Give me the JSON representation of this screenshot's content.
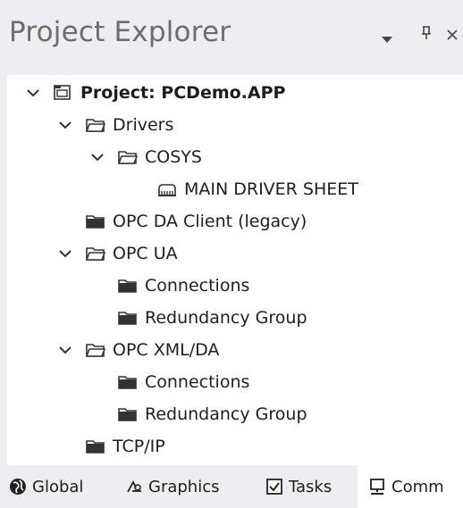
{
  "panel": {
    "title": "Project Explorer",
    "controls": {
      "dropdown": "▾",
      "pin": "ᛘ",
      "close": "×"
    }
  },
  "tree": {
    "root": "Project: PCDemo.APP",
    "drivers": "Drivers",
    "cosys": "COSYS",
    "main_driver_sheet": "MAIN DRIVER SHEET",
    "opc_da": "OPC DA Client (legacy)",
    "opc_ua": "OPC UA",
    "opc_ua_connections": "Connections",
    "opc_ua_redundancy": "Redundancy Group",
    "opc_xml": "OPC XML/DA",
    "opc_xml_connections": "Connections",
    "opc_xml_redundancy": "Redundancy Group",
    "tcpip": "TCP/IP"
  },
  "tabs": {
    "global": "Global",
    "graphics": "Graphics",
    "tasks": "Tasks",
    "comm": "Comm"
  },
  "icons": {
    "expand": "chevron-down-icon",
    "root": "project-icon",
    "folder_open": "folder-open-icon",
    "folder_closed": "folder-icon",
    "driver_sheet": "driver-sheet-icon",
    "global": "globe-icon",
    "graphics": "graphics-icon",
    "tasks": "tasks-icon",
    "comm": "monitor-icon"
  },
  "colors": {
    "background": "#eeeef2",
    "tree_bg": "#ffffff",
    "text": "#1e1e1e",
    "title": "#6d6d6d"
  }
}
